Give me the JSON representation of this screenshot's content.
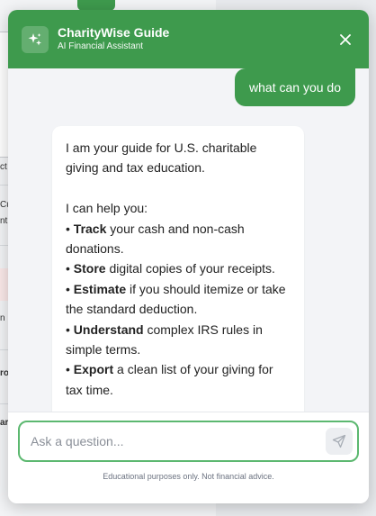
{
  "background_page": {
    "fragments": [
      "ct",
      "Cu",
      "nti",
      "n",
      "ro",
      "ar"
    ]
  },
  "header": {
    "title": "CharityWise Guide",
    "subtitle": "AI Financial Assistant",
    "logo_icon": "sparkle-icon",
    "close_icon": "close-icon"
  },
  "messages": {
    "user": "what can you do",
    "bot": {
      "intro": "I am your guide for U.S. charitable giving and tax education.",
      "lead": "I can help you:",
      "items": [
        {
          "bold": "Track",
          "rest": " your cash and non-cash donations."
        },
        {
          "bold": "Store",
          "rest": " digital copies of your receipts."
        },
        {
          "bold": "Estimate",
          "rest": " if you should itemize or take the standard deduction."
        },
        {
          "bold": "Understand",
          "rest": " complex IRS rules in simple terms."
        },
        {
          "bold": "Export",
          "rest": " a clean list of your giving for tax time."
        }
      ]
    }
  },
  "input": {
    "placeholder": "Ask a question...",
    "value": "",
    "send_icon": "send-icon"
  },
  "disclaimer": "Educational purposes only. Not financial advice.",
  "colors": {
    "brand_green": "#3e9a4d",
    "input_border": "#5cb870",
    "panel_bg": "#f3f4f7"
  }
}
